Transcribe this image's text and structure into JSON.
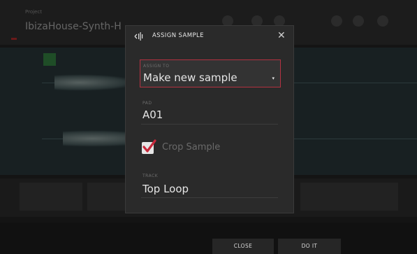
{
  "app": {
    "project_label": "Project",
    "project_name": "IbizaHouse-Synth-H"
  },
  "dialog": {
    "title": "ASSIGN SAMPLE",
    "assign_to": {
      "label": "ASSIGN TO",
      "value": "Make new sample"
    },
    "pad": {
      "label": "PAD",
      "value": "A01"
    },
    "crop_sample": {
      "label": "Crop Sample",
      "checked": true
    },
    "track": {
      "label": "TRACK",
      "value": "Top Loop"
    }
  },
  "buttons": {
    "close": "CLOSE",
    "do_it": "DO IT"
  },
  "colors": {
    "accent_red": "#b33241",
    "check_red": "#c8283b"
  }
}
